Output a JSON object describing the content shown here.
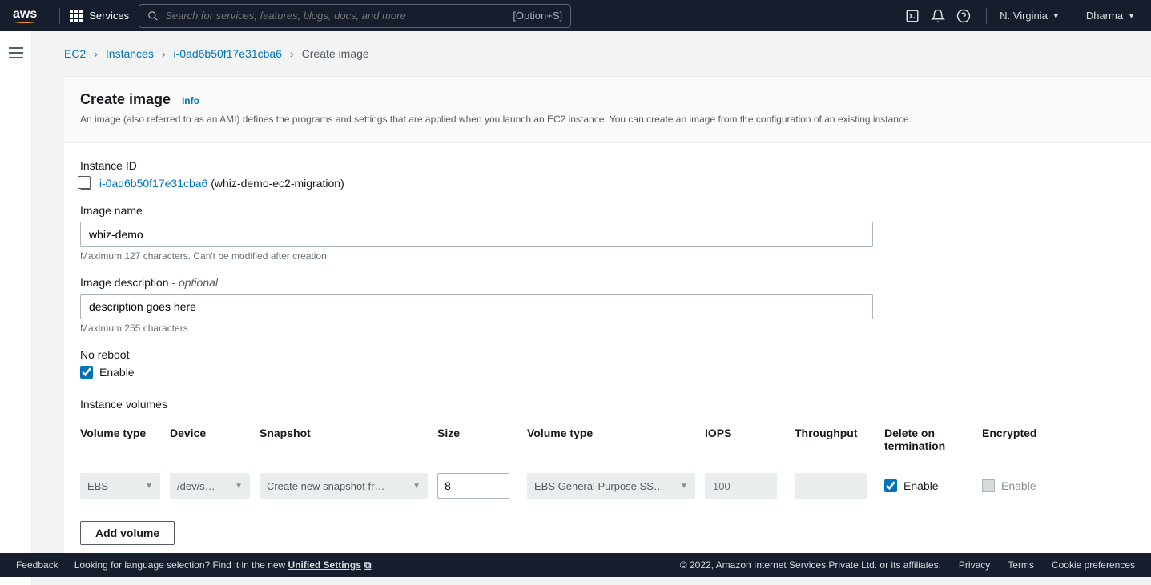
{
  "topbar": {
    "logo_text": "aws",
    "services_label": "Services",
    "search_placeholder": "Search for services, features, blogs, docs, and more",
    "search_shortcut": "[Option+S]",
    "region": "N. Virginia",
    "user": "Dharma"
  },
  "breadcrumb": {
    "items": [
      {
        "label": "EC2"
      },
      {
        "label": "Instances"
      },
      {
        "label": "i-0ad6b50f17e31cba6"
      }
    ],
    "current": "Create image"
  },
  "page": {
    "title": "Create image",
    "info_label": "Info",
    "description": "An image (also referred to as an AMI) defines the programs and settings that are applied when you launch an EC2 instance. You can create an image from the configuration of an existing instance."
  },
  "form": {
    "instance_id_label": "Instance ID",
    "instance_id": "i-0ad6b50f17e31cba6",
    "instance_name": "(whiz-demo-ec2-migration)",
    "image_name_label": "Image name",
    "image_name_value": "whiz-demo",
    "image_name_hint": "Maximum 127 characters. Can't be modified after creation.",
    "image_desc_label": "Image description",
    "image_desc_optional": " - optional",
    "image_desc_value": "description goes here",
    "image_desc_hint": "Maximum 255 characters",
    "no_reboot_label": "No reboot",
    "enable_label": "Enable"
  },
  "volumes": {
    "section_title": "Instance volumes",
    "headers": {
      "vol_type1": "Volume type",
      "device": "Device",
      "snapshot": "Snapshot",
      "size": "Size",
      "vol_type2": "Volume type",
      "iops": "IOPS",
      "throughput": "Throughput",
      "delete_on_term": "Delete on termination",
      "encrypted": "Encrypted"
    },
    "row": {
      "vol_type1": "EBS",
      "device": "/dev/s…",
      "snapshot": "Create new snapshot fr…",
      "size": "8",
      "vol_type2": "EBS General Purpose SS…",
      "iops": "100",
      "throughput": "",
      "delete_enable": "Enable",
      "encrypted_enable": "Enable"
    },
    "add_button": "Add volume"
  },
  "footer": {
    "feedback": "Feedback",
    "lang_prefix": "Looking for language selection? Find it in the new ",
    "lang_link": "Unified Settings",
    "copyright": "© 2022, Amazon Internet Services Private Ltd. or its affiliates.",
    "privacy": "Privacy",
    "terms": "Terms",
    "cookie": "Cookie preferences"
  }
}
